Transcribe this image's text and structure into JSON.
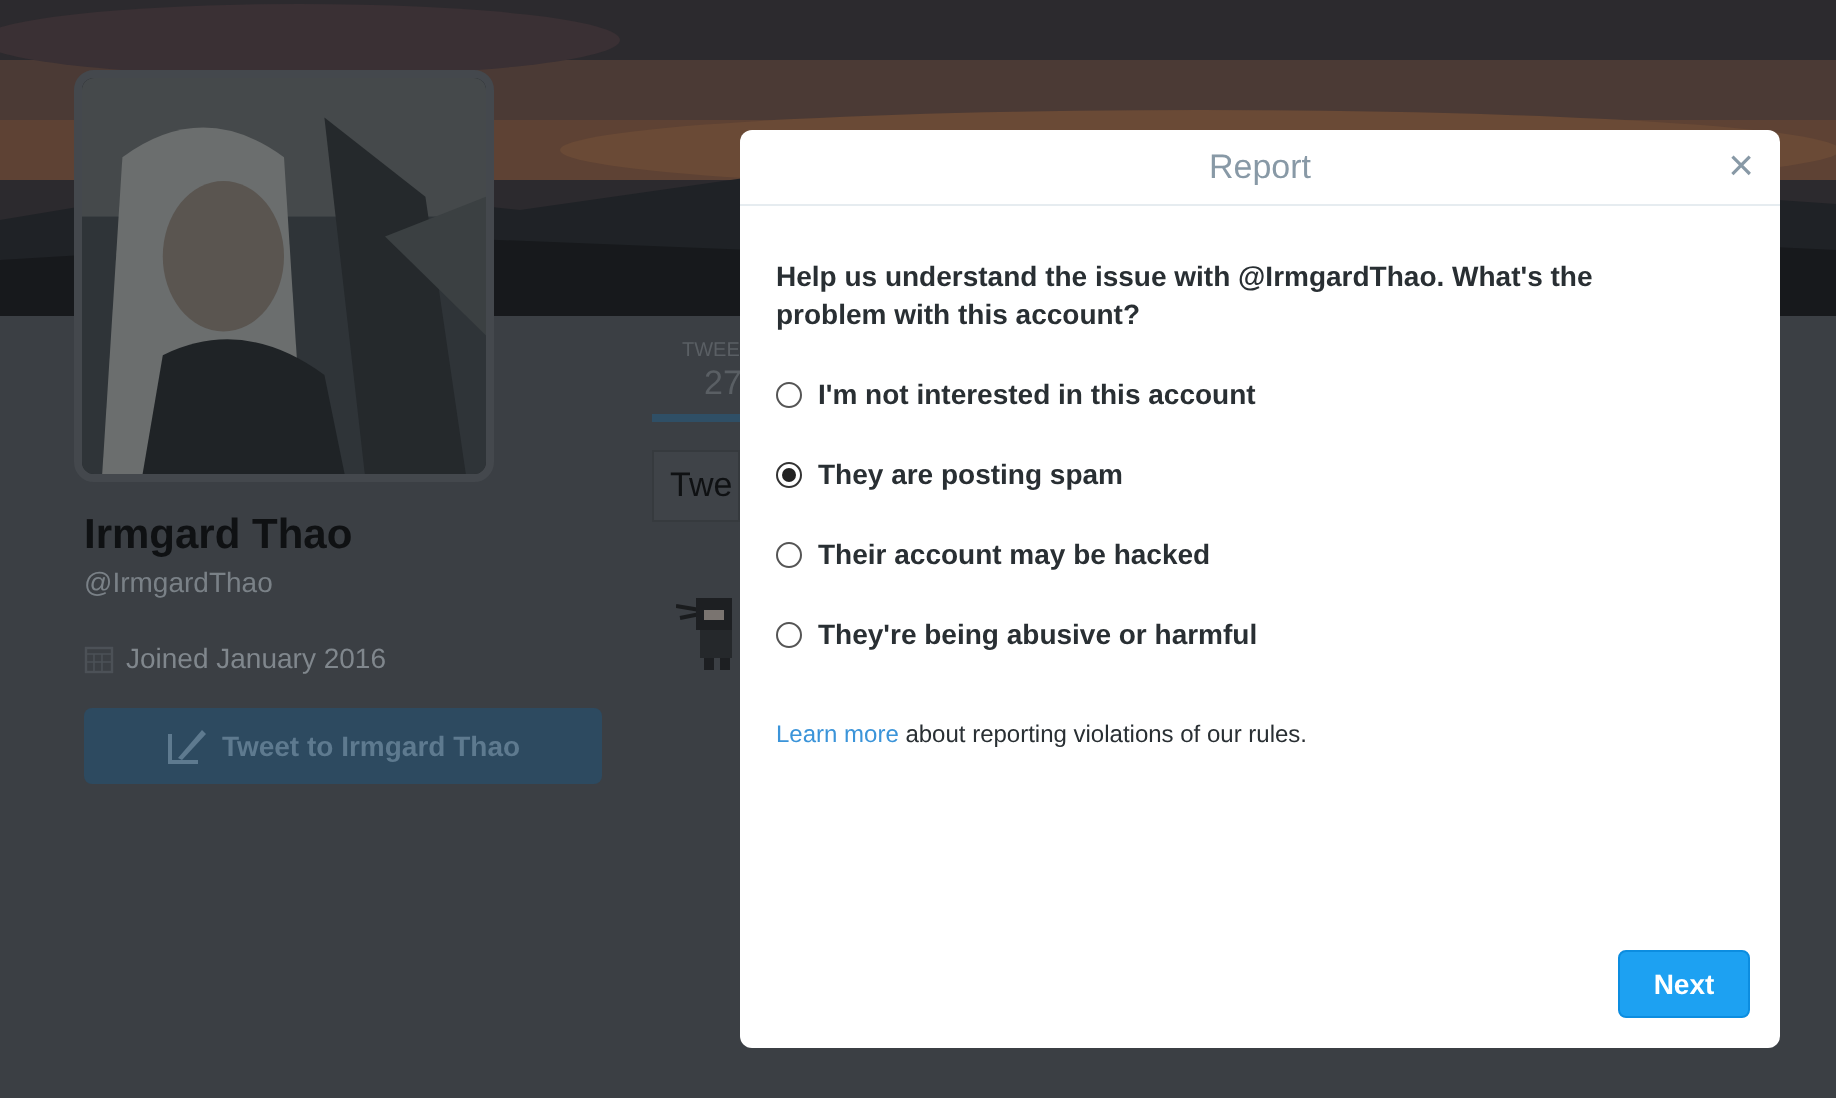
{
  "profile": {
    "name": "Irmgard Thao",
    "handle": "@IrmgardThao",
    "joined": "Joined January 2016",
    "tweet_button": "Tweet to Irmgard Thao"
  },
  "stats": {
    "label": "TWEE",
    "count": "27"
  },
  "timeline_heading": "Twe",
  "dialog": {
    "title": "Report",
    "close": "×",
    "question": "Help us understand the issue with @IrmgardThao. What's the problem with this account?",
    "options": [
      {
        "label": "I'm not interested in this account",
        "selected": false
      },
      {
        "label": "They are posting spam",
        "selected": true
      },
      {
        "label": "Their account may be hacked",
        "selected": false
      },
      {
        "label": "They're being abusive or harmful",
        "selected": false
      }
    ],
    "link": "Learn more",
    "link_after": " about reporting violations of our rules.",
    "next_button": "Next"
  }
}
